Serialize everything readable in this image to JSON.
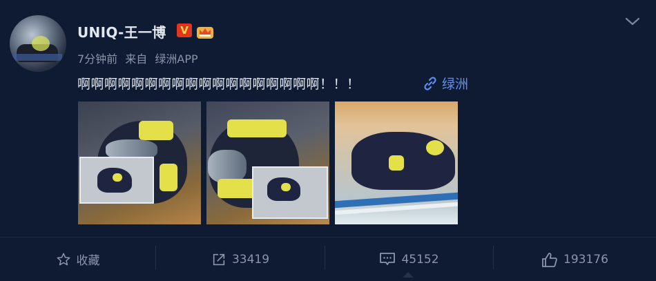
{
  "post": {
    "username": "UNIQ-王一博",
    "verified_badge": "V",
    "time": "7分钟前",
    "from_label": "来自",
    "source": "绿洲APP",
    "text": "啊啊啊啊啊啊啊啊啊啊啊啊啊啊啊啊啊啊！！！",
    "link_label": "绿洲"
  },
  "actions": {
    "favorite_label": "收藏",
    "forward_count": "33419",
    "comment_count": "45152",
    "like_count": "193176"
  },
  "colors": {
    "background": "#0f1b33",
    "link": "#5e8ff2",
    "badge": "#e0351f"
  },
  "icons": [
    "chevron-down-icon",
    "crown-icon",
    "link-icon",
    "star-icon",
    "forward-icon",
    "comment-icon",
    "like-icon"
  ]
}
